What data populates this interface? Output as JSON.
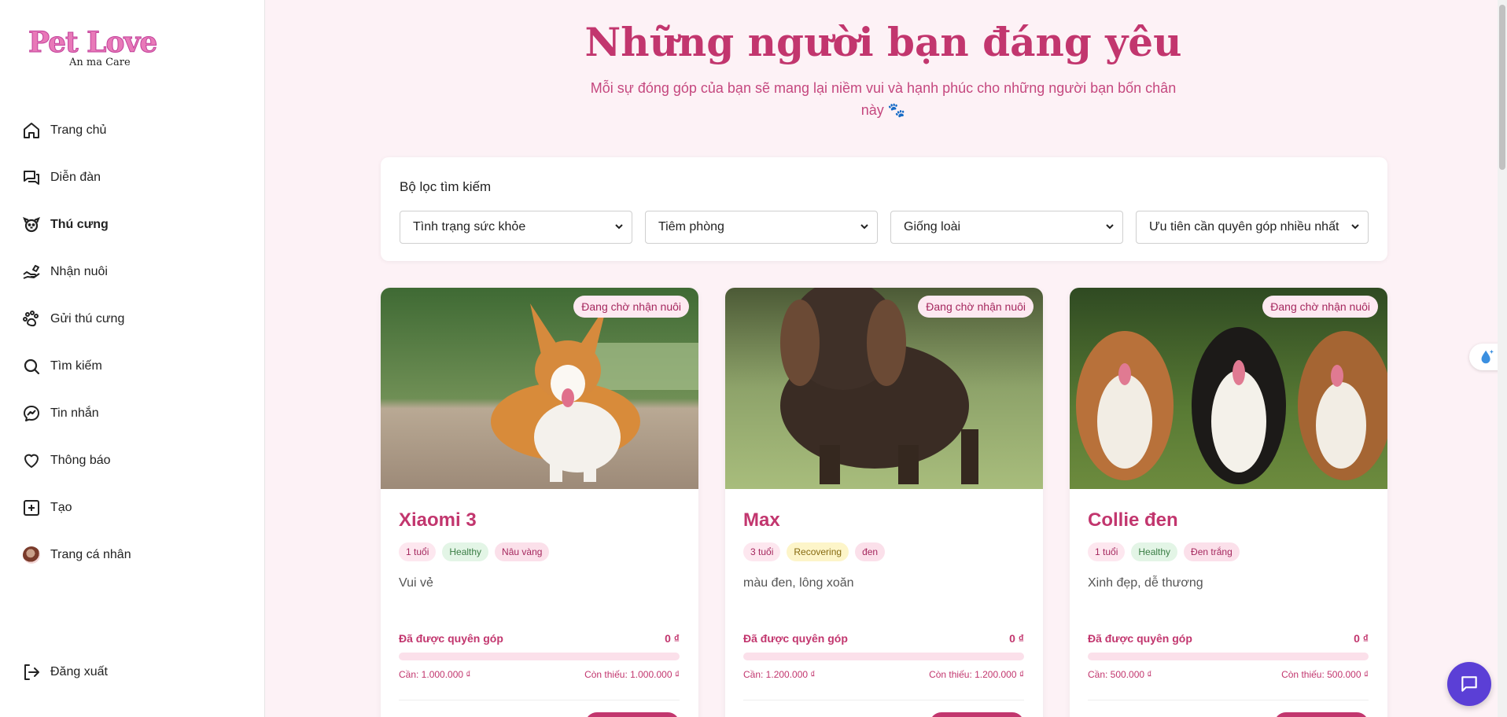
{
  "logo": {
    "brand": "Pet Love",
    "tagline": "An ma Care"
  },
  "sidebar": {
    "items": [
      {
        "label": "Trang chủ",
        "icon": "home-icon"
      },
      {
        "label": "Diễn đàn",
        "icon": "forum-icon"
      },
      {
        "label": "Thú cưng",
        "icon": "pet-icon",
        "active": true
      },
      {
        "label": "Nhận nuôi",
        "icon": "adopt-icon"
      },
      {
        "label": "Gửi thú cưng",
        "icon": "paw-icon"
      },
      {
        "label": "Tìm kiếm",
        "icon": "search-icon"
      },
      {
        "label": "Tin nhắn",
        "icon": "messenger-icon"
      },
      {
        "label": "Thông báo",
        "icon": "heart-icon"
      },
      {
        "label": "Tạo",
        "icon": "plus-square-icon"
      },
      {
        "label": "Trang cá nhân",
        "icon": "avatar"
      }
    ],
    "logout": "Đăng xuất"
  },
  "hero": {
    "title": "Những người bạn đáng yêu",
    "subtitle": "Mỗi sự đóng góp của bạn sẽ mang lại niềm vui và hạnh phúc cho những người bạn bốn chân này 🐾"
  },
  "filters": {
    "title": "Bộ lọc tìm kiếm",
    "health": "Tình trạng sức khỏe",
    "vaccine": "Tiêm phòng",
    "breed": "Giống loài",
    "sort": "Ưu tiên cần quyên góp nhiều nhất"
  },
  "pets": [
    {
      "status": "Đang chờ nhận nuôi",
      "name": "Xiaomi 3",
      "age": "1 tuổi",
      "health": "Healthy",
      "color": "Nâu vàng",
      "desc": "Vui vẻ",
      "donated_label": "Đã được quyên góp",
      "donated": "0 ₫",
      "progress": 0,
      "need": "Cần: 1.000.000 ₫",
      "remain": "Còn thiếu: 1.000.000 ₫"
    },
    {
      "status": "Đang chờ nhận nuôi",
      "name": "Max",
      "age": "3 tuổi",
      "health": "Recovering",
      "color": "đen",
      "desc": "màu đen, lông xoăn",
      "donated_label": "Đã được quyên góp",
      "donated": "0 ₫",
      "progress": 0,
      "need": "Cần: 1.200.000 ₫",
      "remain": "Còn thiếu: 1.200.000 ₫"
    },
    {
      "status": "Đang chờ nhận nuôi",
      "name": "Collie đen",
      "age": "1 tuổi",
      "health": "Healthy",
      "color": "Đen trắng",
      "desc": "Xinh đẹp, dễ thương",
      "donated_label": "Đã được quyên góp",
      "donated": "0 ₫",
      "progress": 0,
      "need": "Cần: 500.000 ₫",
      "remain": "Còn thiếu: 500.000 ₫"
    }
  ],
  "colors": {
    "accent": "#c2366e",
    "fab": "#5b3fd6"
  }
}
